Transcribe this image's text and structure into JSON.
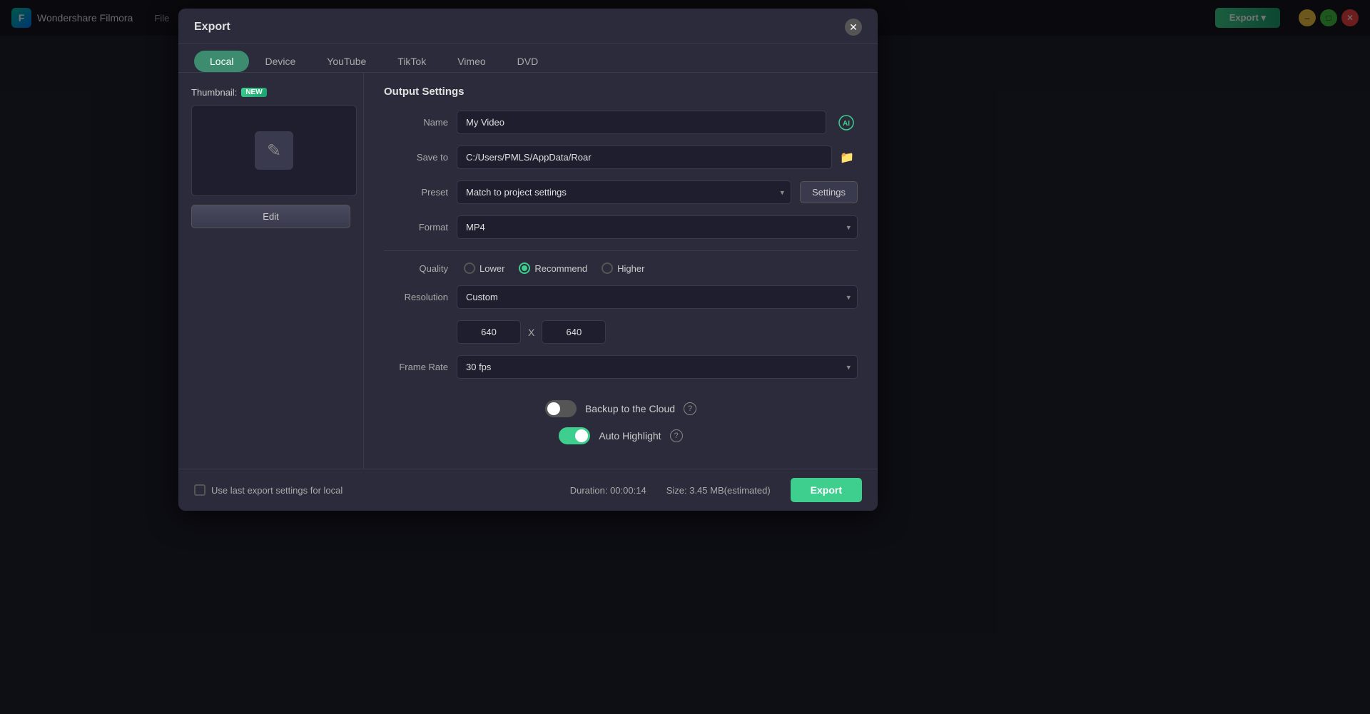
{
  "app": {
    "title": "Wondershare Filmora",
    "menu_items": [
      "File"
    ],
    "export_btn_label": "Export ▾",
    "win_minimize": "–",
    "win_maximize": "□",
    "win_close": "✕"
  },
  "dialog": {
    "title": "Export",
    "close_icon": "✕",
    "tabs": [
      {
        "id": "local",
        "label": "Local",
        "active": true
      },
      {
        "id": "device",
        "label": "Device",
        "active": false
      },
      {
        "id": "youtube",
        "label": "YouTube",
        "active": false
      },
      {
        "id": "tiktok",
        "label": "TikTok",
        "active": false
      },
      {
        "id": "vimeo",
        "label": "Vimeo",
        "active": false
      },
      {
        "id": "dvd",
        "label": "DVD",
        "active": false
      }
    ],
    "thumbnail": {
      "label": "Thumbnail:",
      "new_badge": "NEW",
      "edit_btn": "Edit"
    },
    "output_settings": {
      "section_title": "Output Settings",
      "name_label": "Name",
      "name_value": "My Video",
      "save_to_label": "Save to",
      "save_to_value": "C:/Users/PMLS/AppData/Roar",
      "preset_label": "Preset",
      "preset_value": "Match to project settings",
      "settings_btn": "Settings",
      "format_label": "Format",
      "format_value": "MP4",
      "quality_label": "Quality",
      "quality_options": [
        {
          "id": "lower",
          "label": "Lower",
          "checked": false
        },
        {
          "id": "recommend",
          "label": "Recommend",
          "checked": true
        },
        {
          "id": "higher",
          "label": "Higher",
          "checked": false
        }
      ],
      "resolution_label": "Resolution",
      "resolution_value": "Custom",
      "res_width": "640",
      "res_x": "X",
      "res_height": "640",
      "frame_rate_label": "Frame Rate",
      "frame_rate_value": "30 fps",
      "backup_cloud_label": "Backup to the Cloud",
      "backup_cloud_on": true,
      "auto_highlight_label": "Auto Highlight",
      "auto_highlight_on": true
    },
    "footer": {
      "checkbox_label": "Use last export settings for local",
      "duration_label": "Duration:",
      "duration_value": "00:00:14",
      "size_label": "Size:",
      "size_value": "3.45 MB(estimated)",
      "export_btn": "Export"
    }
  }
}
